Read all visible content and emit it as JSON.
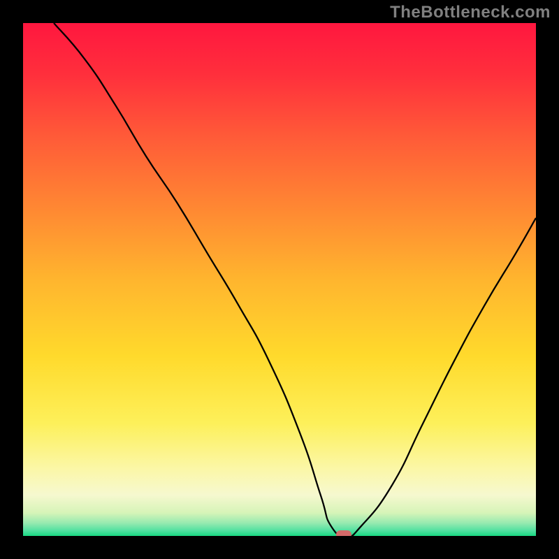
{
  "watermark": "TheBottleneck.com",
  "chart_data": {
    "type": "line",
    "title": "",
    "xlabel": "",
    "ylabel": "",
    "xlim": [
      0,
      100
    ],
    "ylim": [
      0,
      100
    ],
    "x": [
      6,
      12,
      18,
      24,
      30,
      36,
      42,
      48,
      54,
      58,
      60,
      63,
      66,
      72,
      78,
      84,
      90,
      96,
      100
    ],
    "values": [
      100,
      93,
      84,
      74,
      65,
      55,
      45,
      34,
      20,
      8,
      2,
      0,
      2,
      10,
      22,
      34,
      45,
      55,
      62
    ],
    "marker_x": 62.5,
    "marker_y": 0,
    "gradient_stops": [
      {
        "pos": 0.0,
        "color": "#ff173f"
      },
      {
        "pos": 0.1,
        "color": "#ff2f3c"
      },
      {
        "pos": 0.22,
        "color": "#ff5a38"
      },
      {
        "pos": 0.35,
        "color": "#ff8433"
      },
      {
        "pos": 0.5,
        "color": "#ffb52e"
      },
      {
        "pos": 0.65,
        "color": "#ffda2c"
      },
      {
        "pos": 0.78,
        "color": "#fdf05a"
      },
      {
        "pos": 0.87,
        "color": "#fbf7a8"
      },
      {
        "pos": 0.92,
        "color": "#f6f8cf"
      },
      {
        "pos": 0.955,
        "color": "#d6f4b8"
      },
      {
        "pos": 0.975,
        "color": "#96eab0"
      },
      {
        "pos": 0.99,
        "color": "#4fe0a0"
      },
      {
        "pos": 1.0,
        "color": "#18d982"
      }
    ]
  }
}
